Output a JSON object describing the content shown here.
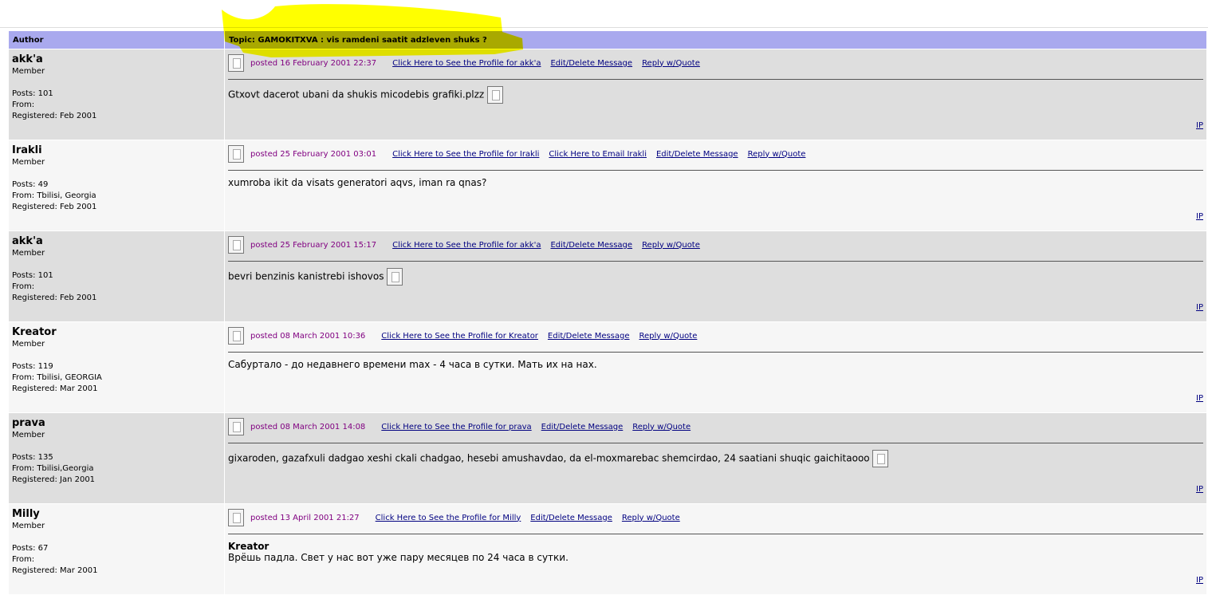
{
  "header": {
    "author": "Author",
    "topic": "Topic:  GAMOKITXVA : vis ramdeni saatit adzleven shuks ?"
  },
  "posts": [
    {
      "name": "akk'a",
      "rank": "Member",
      "posts": "Posts: 101",
      "from": "From: ",
      "registered": "Registered: Feb 2001",
      "posted": "posted 16 February 2001 22:37",
      "links": [
        "Click Here to See the Profile for akk'a",
        "Edit/Delete Message",
        "Reply w/Quote"
      ],
      "quote_author": "",
      "body": "Gtxovt dacerot ubani da shukis micodebis grafiki.plzz",
      "has_img": true,
      "ip": "IP"
    },
    {
      "name": "Irakli",
      "rank": "Member",
      "posts": "Posts: 49",
      "from": "From: Tbilisi, Georgia",
      "registered": "Registered: Feb 2001",
      "posted": "posted 25 February 2001 03:01",
      "links": [
        "Click Here to See the Profile for Irakli",
        "Click Here to Email Irakli",
        "Edit/Delete Message",
        "Reply w/Quote"
      ],
      "quote_author": "",
      "body": "xumroba ikit da visats generatori aqvs, iman ra qnas?",
      "has_img": false,
      "ip": "IP"
    },
    {
      "name": "akk'a",
      "rank": "Member",
      "posts": "Posts: 101",
      "from": "From: ",
      "registered": "Registered: Feb 2001",
      "posted": "posted 25 February 2001 15:17",
      "links": [
        "Click Here to See the Profile for akk'a",
        "Edit/Delete Message",
        "Reply w/Quote"
      ],
      "quote_author": "",
      "body": "bevri benzinis kanistrebi ishovos",
      "has_img": true,
      "ip": "IP"
    },
    {
      "name": "Kreator",
      "rank": "Member",
      "posts": "Posts: 119",
      "from": "From: Tbilisi, GEORGIA",
      "registered": "Registered: Mar 2001",
      "posted": "posted 08 March 2001 10:36",
      "links": [
        "Click Here to See the Profile for Kreator",
        "Edit/Delete Message",
        "Reply w/Quote"
      ],
      "quote_author": "",
      "body": "Сабуртало - до недавнего времени max - 4 часа в сутки. Мать их на нах.",
      "has_img": false,
      "ip": "IP"
    },
    {
      "name": "prava",
      "rank": "Member",
      "posts": "Posts: 135",
      "from": "From: Tbilisi,Georgia",
      "registered": "Registered: Jan 2001",
      "posted": "posted 08 March 2001 14:08",
      "links": [
        "Click Here to See the Profile for prava",
        "Edit/Delete Message",
        "Reply w/Quote"
      ],
      "quote_author": "",
      "body": "gixaroden, gazafxuli dadgao xeshi ckali chadgao, hesebi amushavdao, da el-moxmarebac shemcirdao, 24 saatiani shuqic gaichitaooo",
      "has_img": true,
      "ip": "IP"
    },
    {
      "name": "Milly",
      "rank": "Member",
      "posts": "Posts: 67",
      "from": "From: ",
      "registered": "Registered: Mar 2001",
      "posted": "posted 13 April 2001 21:27",
      "links": [
        "Click Here to See the Profile for Milly",
        "Edit/Delete Message",
        "Reply w/Quote"
      ],
      "quote_author": "Kreator",
      "body": "Врёшь падла. Свет у нас вот уже пару месяцев по 24 часа в сутки.",
      "has_img": false,
      "ip": "IP"
    }
  ]
}
